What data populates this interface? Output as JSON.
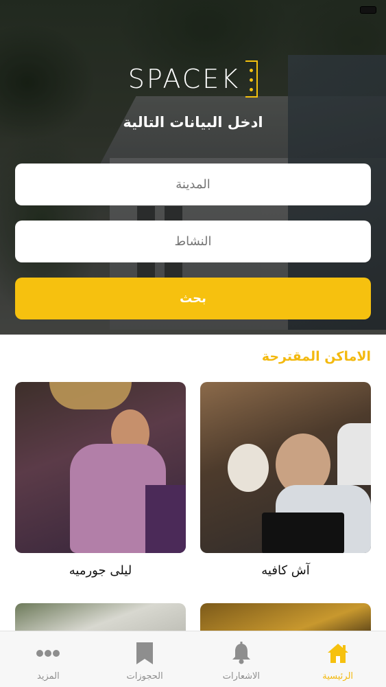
{
  "header": {
    "logo_text": "SPACEK",
    "subtitle": "ادخل البيانات التالية"
  },
  "form": {
    "city_placeholder": "المدينة",
    "activity_placeholder": "النشاط",
    "search_label": "بحث"
  },
  "suggested": {
    "title": "الاماكن المقترحة",
    "places": [
      {
        "name": "آش كافيه"
      },
      {
        "name": "ليلى جورميه"
      }
    ]
  },
  "tabs": [
    {
      "label": "الرئيسية",
      "icon": "home-icon",
      "active": true
    },
    {
      "label": "الاشعارات",
      "icon": "bell-icon",
      "active": false
    },
    {
      "label": "الحجوزات",
      "icon": "bookmark-icon",
      "active": false
    },
    {
      "label": "المزيد",
      "icon": "more-icon",
      "active": false
    }
  ],
  "colors": {
    "accent": "#f6c10f",
    "inactive_tab": "#8e8e8e"
  }
}
